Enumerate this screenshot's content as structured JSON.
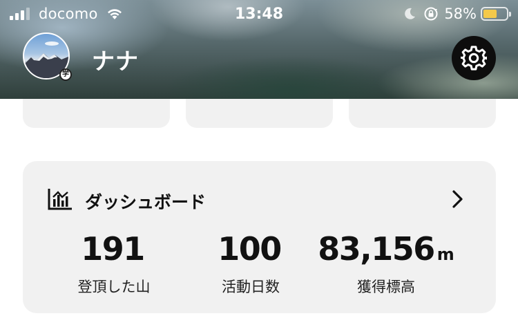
{
  "status_bar": {
    "carrier": "docomo",
    "time": "13:48",
    "battery_percent": "58%",
    "battery_level": 0.58,
    "battery_color": "#f4c94a"
  },
  "profile": {
    "name": "ナナ",
    "badge": "学"
  },
  "dashboard": {
    "title": "ダッシュボード",
    "stats": [
      {
        "value": "191",
        "unit": "",
        "label": "登頂した山"
      },
      {
        "value": "100",
        "unit": "",
        "label": "活動日数"
      },
      {
        "value": "83,156",
        "unit": "m",
        "label": "獲得標高"
      }
    ]
  },
  "icons": {
    "settings": "gear-icon",
    "dashboard": "bar-chart-icon",
    "next": "chevron-right-icon"
  }
}
